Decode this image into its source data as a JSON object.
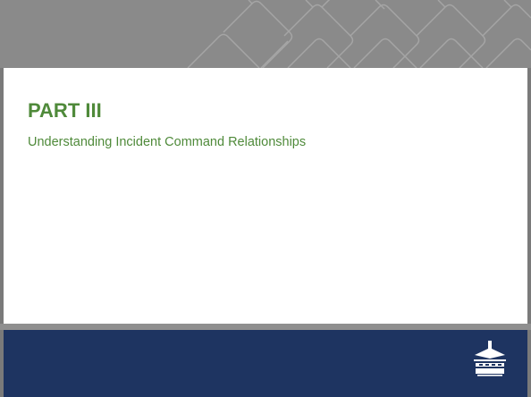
{
  "slide": {
    "title": "PART III",
    "subtitle": "Understanding Incident Command Relationships"
  },
  "theme": {
    "accent_green": "#4f8a3a",
    "header_gray": "#8a8a8a",
    "footer_navy": "#1e3461"
  },
  "icons": {
    "header_pattern": "diamond-lattice-pattern",
    "logo": "valley-logo-icon"
  }
}
